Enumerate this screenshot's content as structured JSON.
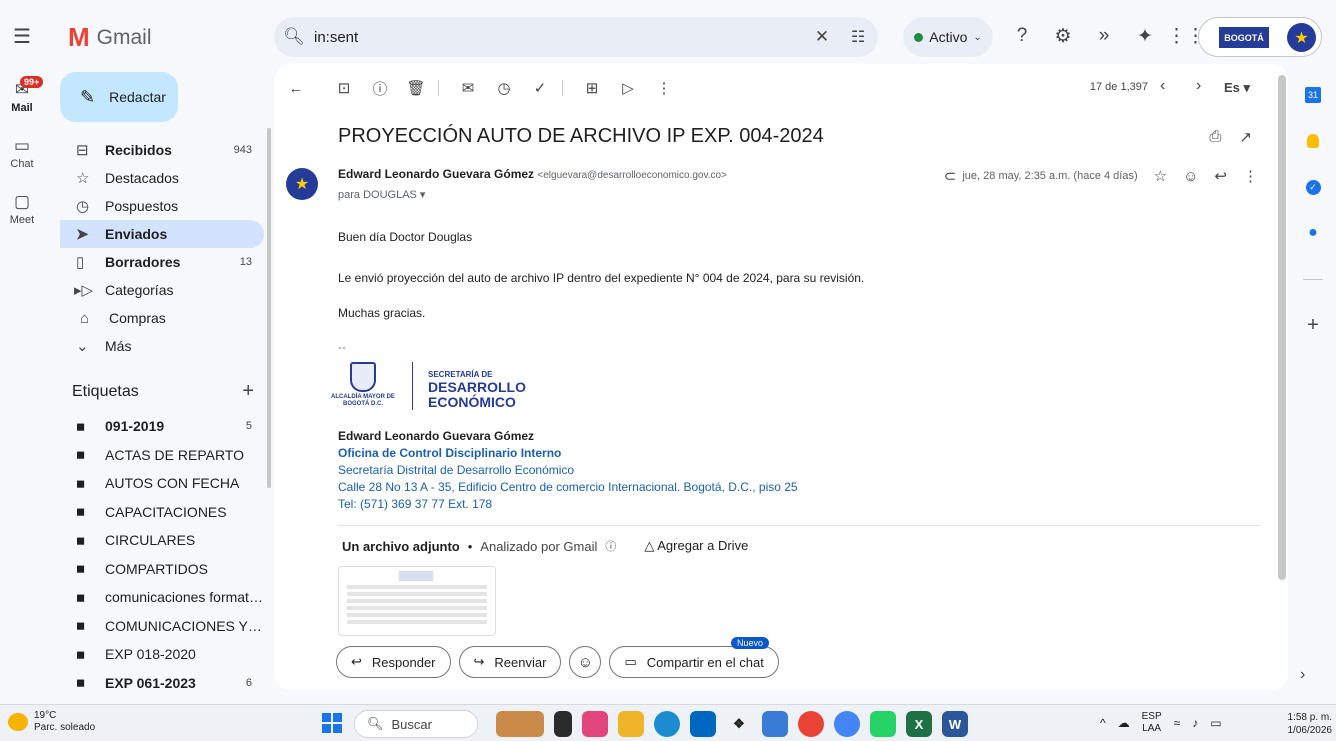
{
  "app": {
    "name": "Gmail",
    "logo_letter": "M"
  },
  "search": {
    "query": "in:sent"
  },
  "status": {
    "label": "Activo"
  },
  "org": {
    "badge": "BOGOTÁ"
  },
  "rail": [
    {
      "label": "Mail",
      "badge": "99+"
    },
    {
      "label": "Chat"
    },
    {
      "label": "Meet"
    }
  ],
  "compose": {
    "label": "Redactar"
  },
  "nav": [
    {
      "label": "Recibidos",
      "count": "943"
    },
    {
      "label": "Destacados",
      "count": ""
    },
    {
      "label": "Pospuestos",
      "count": ""
    },
    {
      "label": "Enviados",
      "count": ""
    },
    {
      "label": "Borradores",
      "count": "13"
    },
    {
      "label": "Categorías",
      "count": ""
    },
    {
      "label": "Compras",
      "count": ""
    },
    {
      "label": "Más",
      "count": ""
    }
  ],
  "labels_section": {
    "title": "Etiquetas"
  },
  "labels": [
    {
      "label": "091-2019",
      "count": "5"
    },
    {
      "label": "ACTAS DE REPARTO",
      "count": ""
    },
    {
      "label": "AUTOS CON FECHA",
      "count": ""
    },
    {
      "label": "CAPACITACIONES",
      "count": ""
    },
    {
      "label": "CIRCULARES",
      "count": ""
    },
    {
      "label": "COMPARTIDOS",
      "count": ""
    },
    {
      "label": "comunicaciones formato...",
      "count": ""
    },
    {
      "label": "COMUNICACIONES Y/O ...",
      "count": ""
    },
    {
      "label": "EXP 018-2020",
      "count": ""
    },
    {
      "label": "EXP 061-2023",
      "count": "6"
    }
  ],
  "pager": {
    "text": "17 de 1,397",
    "lang": "Es"
  },
  "email": {
    "subject": "PROYECCIÓN AUTO DE ARCHIVO IP EXP. 004-2024",
    "sender_name": "Edward Leonardo Guevara Gómez",
    "sender_email": "<elguevara@desarrolloeconomico.gov.co>",
    "to": "para DOUGLAS",
    "date": "jue, 28 may, 2:35 a.m. (hace 4 días)",
    "greeting": "Buen día Doctor Douglas",
    "paragraph": "Le envió proyección del auto de archivo IP dentro del expediente N° 004 de 2024, para su revisión.",
    "closing": "Muchas gracias.",
    "sig_dash": "--",
    "sig_logo": {
      "alcaldia": "ALCALDÍA MAYOR DE BOGOTÁ D.C.",
      "secretaria": "SECRETARÍA DE",
      "desarrollo": "DESARROLLO ECONÓMICO"
    },
    "signature": {
      "name": "Edward Leonardo Guevara Gómez",
      "office": "Oficina de Control Disciplinario Interno",
      "entity": "Secretaría Distrital de Desarrollo Económico",
      "address": "Calle 28 No 13 A - 35, Edificio Centro de comercio Internacional. Bogotá, D.C., piso 25",
      "phone": "Tel: (571) 369 37 77 Ext. 178"
    },
    "attachments": {
      "title": "Un archivo adjunto",
      "note": "Analizado por Gmail",
      "drive": "Agregar a Drive"
    }
  },
  "actions": {
    "reply": "Responder",
    "forward": "Reenviar",
    "share": "Compartir en el chat",
    "new_badge": "Nuevo"
  },
  "taskbar": {
    "temp": "19°C",
    "weather": "Parc. soleado",
    "search": "Buscar",
    "lang_top": "ESP",
    "lang_bottom": "LAA",
    "time": "1:58 p. m.",
    "date": "1/06/2026"
  }
}
